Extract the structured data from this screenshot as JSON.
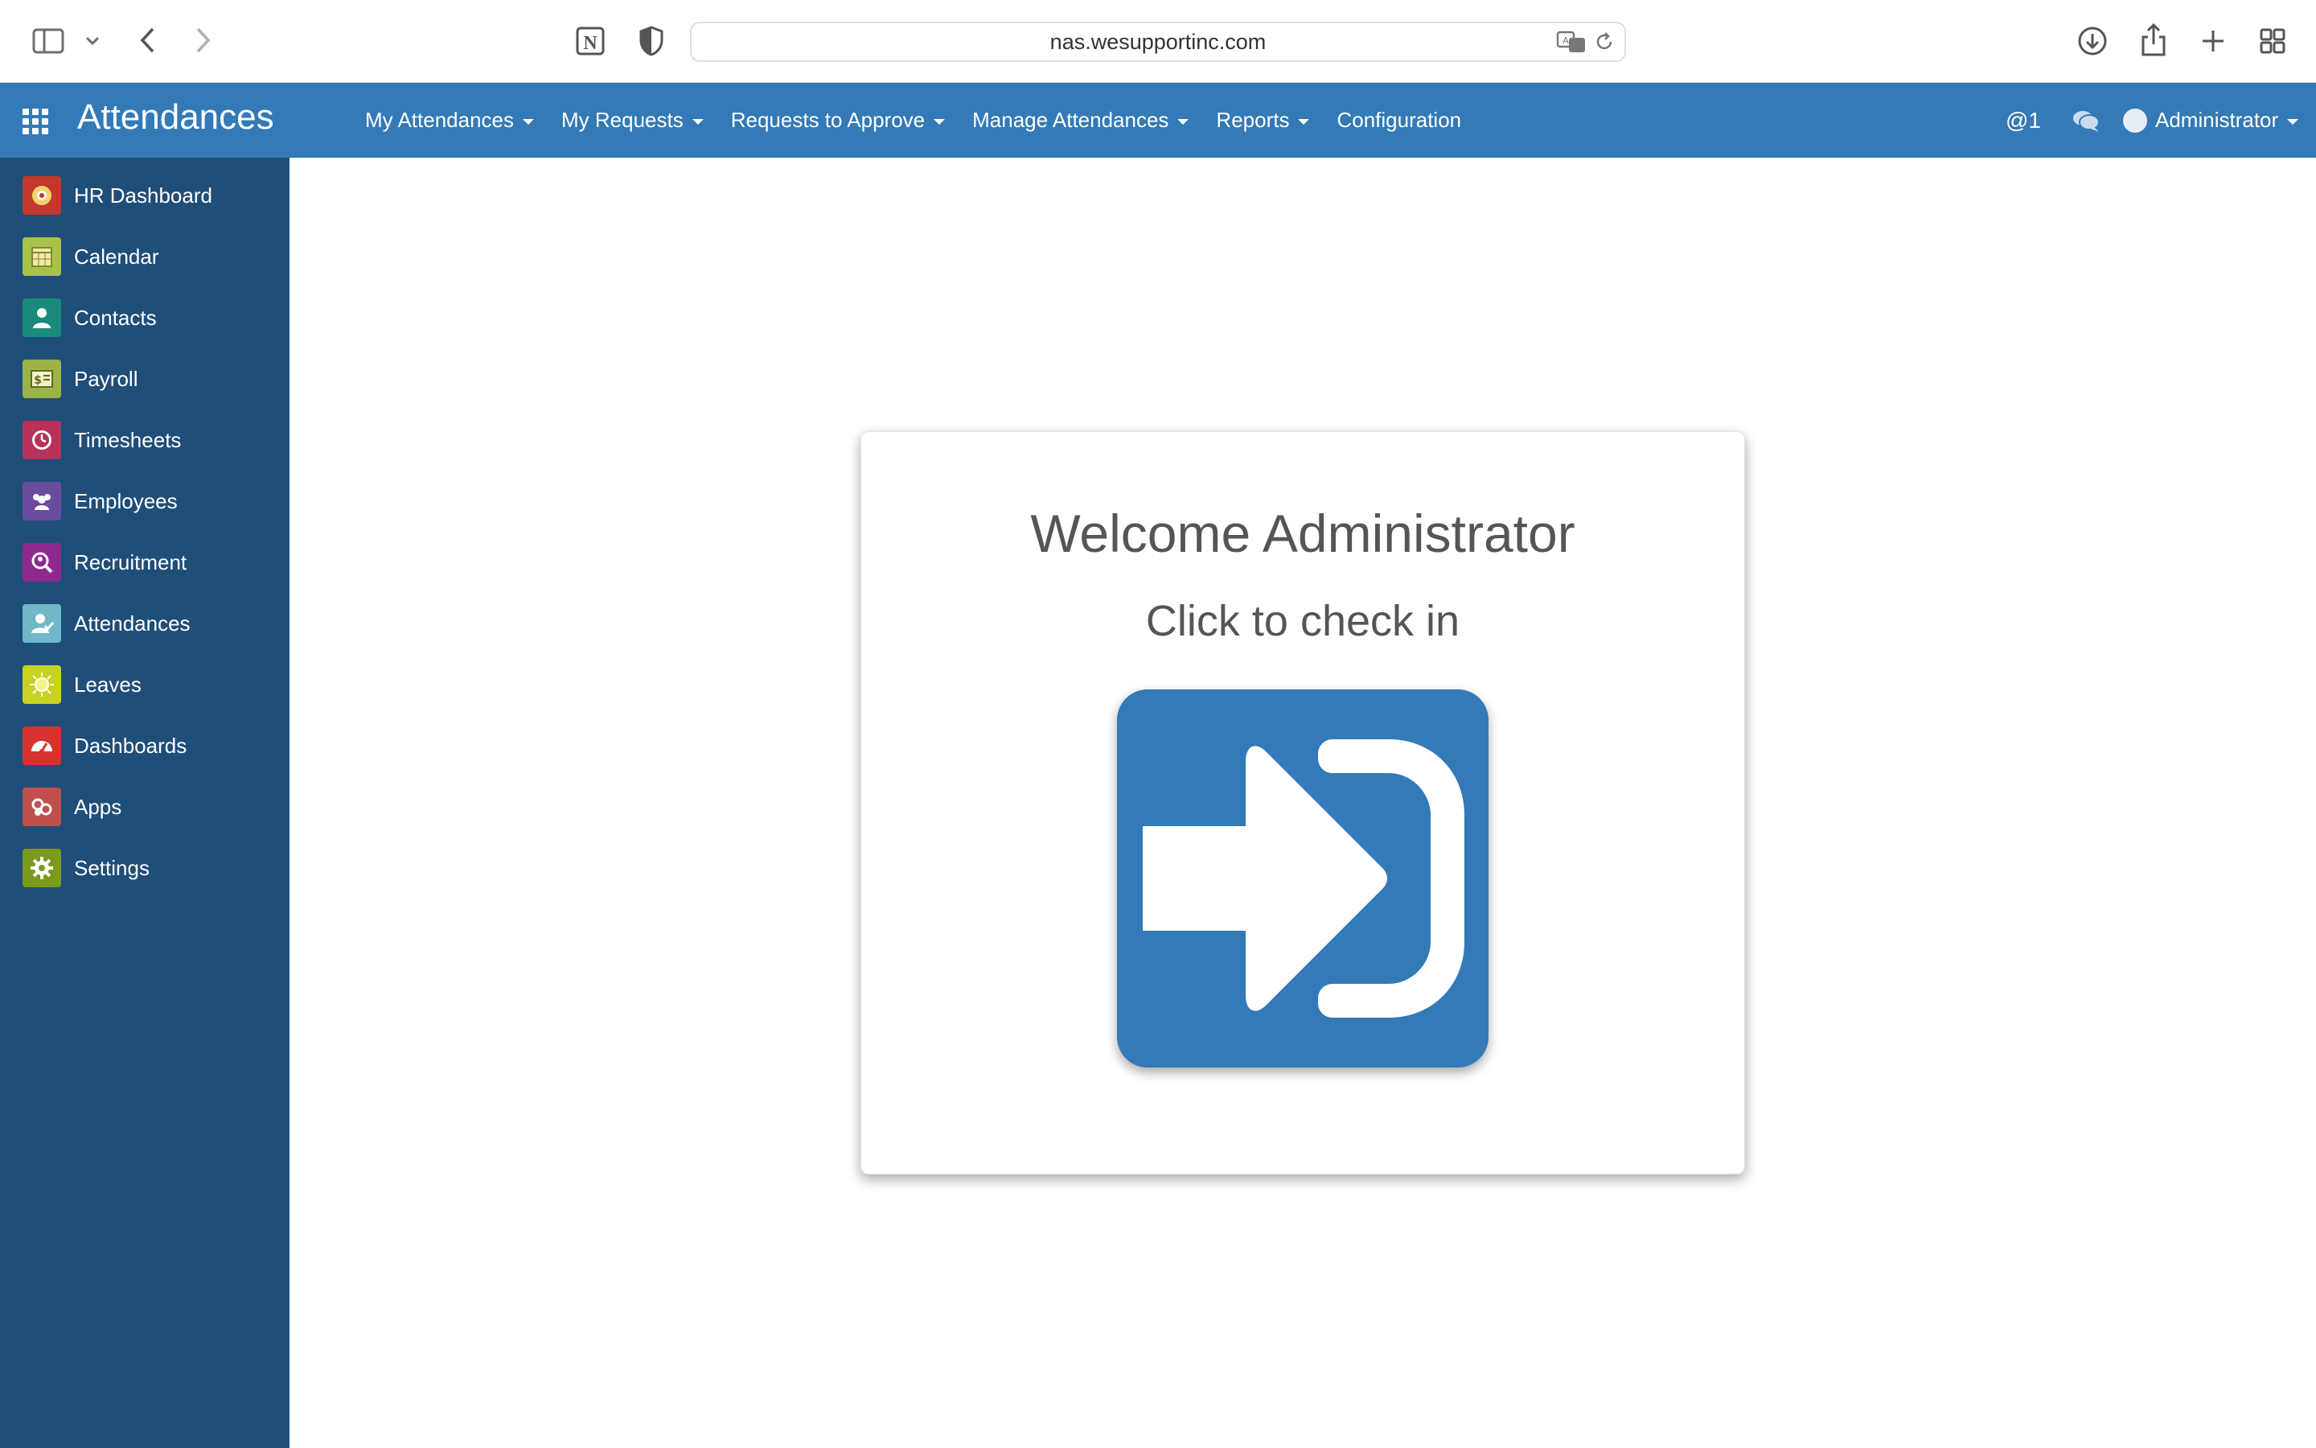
{
  "browser": {
    "url": "nas.wesupportinc.com"
  },
  "navbar": {
    "brand": "Attendances",
    "menu": [
      {
        "label": "My Attendances"
      },
      {
        "label": "My Requests"
      },
      {
        "label": "Requests to Approve"
      },
      {
        "label": "Manage Attendances"
      },
      {
        "label": "Reports"
      },
      {
        "label": "Configuration"
      }
    ],
    "mentions": "@1",
    "user": "Administrator"
  },
  "sidebar": {
    "items": [
      {
        "label": "HR Dashboard",
        "icon": "hr-dashboard-icon",
        "color": "#c0392b"
      },
      {
        "label": "Calendar",
        "icon": "calendar-icon",
        "color": "#a8c24a"
      },
      {
        "label": "Contacts",
        "icon": "contacts-icon",
        "color": "#1a8a7a"
      },
      {
        "label": "Payroll",
        "icon": "payroll-icon",
        "color": "#9bb34a"
      },
      {
        "label": "Timesheets",
        "icon": "timesheets-icon",
        "color": "#b8325a"
      },
      {
        "label": "Employees",
        "icon": "employees-icon",
        "color": "#6a4c9c"
      },
      {
        "label": "Recruitment",
        "icon": "recruitment-icon",
        "color": "#8e2a8e"
      },
      {
        "label": "Attendances",
        "icon": "attendances-icon",
        "color": "#6fb7c9"
      },
      {
        "label": "Leaves",
        "icon": "leaves-icon",
        "color": "#c8d31f"
      },
      {
        "label": "Dashboards",
        "icon": "dashboards-icon",
        "color": "#d8322f"
      },
      {
        "label": "Apps",
        "icon": "apps-icon",
        "color": "#c0504d"
      },
      {
        "label": "Settings",
        "icon": "settings-icon",
        "color": "#7a9a1e"
      }
    ]
  },
  "main": {
    "welcome": "Welcome Administrator",
    "instruction": "Click to check in"
  },
  "colors": {
    "primary": "#337ab7",
    "sidebar": "#1f4e79",
    "text": "#555555"
  }
}
